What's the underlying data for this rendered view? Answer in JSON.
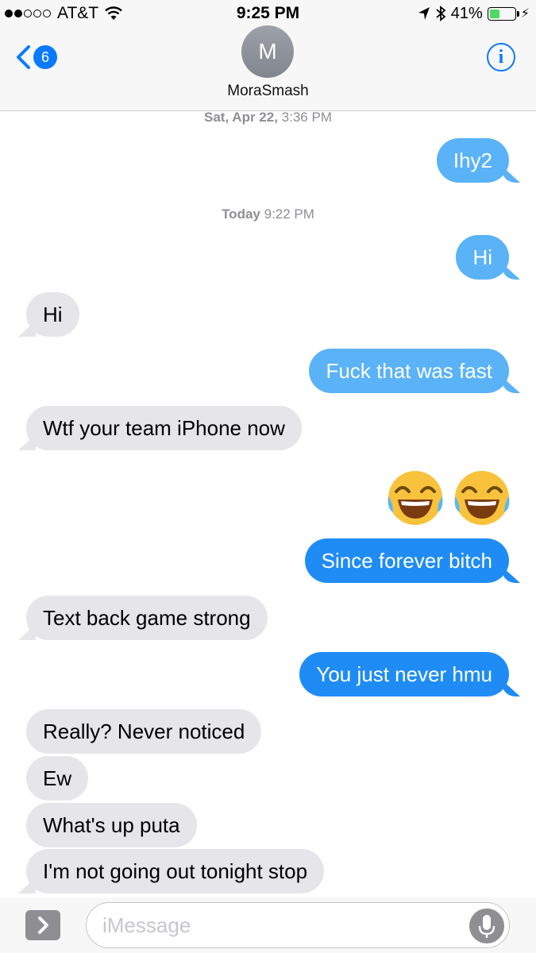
{
  "status_bar": {
    "carrier": "AT&T",
    "signal_dots_filled": 2,
    "signal_dots_total": 5,
    "time": "9:25 PM",
    "battery_percent_label": "41%",
    "battery_level": 0.41,
    "icons": [
      "wifi-icon",
      "location-arrow-icon",
      "bluetooth-icon",
      "battery-icon",
      "charging-bolt-icon"
    ]
  },
  "header": {
    "back_badge": "6",
    "avatar_initial": "M",
    "contact_name": "MoraSmash",
    "info_symbol": "i"
  },
  "thread": {
    "timestamps": [
      {
        "day": "Sat, Apr 22,",
        "time": "3:36 PM"
      },
      {
        "day": "Today",
        "time": "9:22 PM"
      }
    ],
    "messages": [
      {
        "from": "me",
        "text": "Ihy2"
      },
      {
        "from": "me",
        "text": "Hi"
      },
      {
        "from": "them",
        "text": "Hi"
      },
      {
        "from": "me",
        "text": "Fuck that was fast"
      },
      {
        "from": "them",
        "text": "Wtf your team iPhone now"
      },
      {
        "from": "me",
        "emoji": "face-with-tears-of-joy x2"
      },
      {
        "from": "me",
        "text": "Since forever bitch"
      },
      {
        "from": "them",
        "text": "Text back game strong"
      },
      {
        "from": "me",
        "text": "You just never hmu"
      },
      {
        "from": "them",
        "text": "Really? Never noticed"
      },
      {
        "from": "them",
        "text": "Ew"
      },
      {
        "from": "them",
        "text": "What's up puta"
      },
      {
        "from": "them",
        "text": "I'm not going out tonight stop"
      }
    ]
  },
  "input": {
    "placeholder": "iMessage",
    "value": ""
  },
  "colors": {
    "sent_bubble": "#1f8cf5",
    "sent_bubble_old": "#5ab2f7",
    "received_bubble": "#e5e5ea",
    "accent": "#0a7aff",
    "timestamp_text": "#8e8e93"
  }
}
